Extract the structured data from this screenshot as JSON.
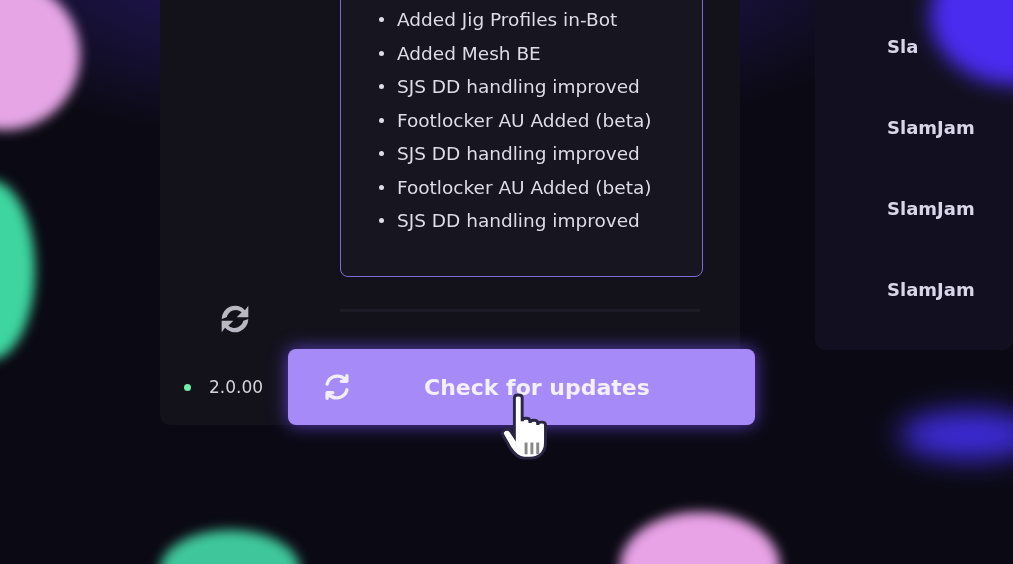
{
  "changelog": {
    "items": [
      "Added Jig Profiles in-Bot",
      "Added Mesh BE",
      "SJS DD handling improved",
      "Footlocker AU Added (beta)",
      "SJS DD handling improved",
      "Footlocker AU Added (beta)",
      "SJS DD handling improved"
    ]
  },
  "status": {
    "online": true,
    "version": "2.0.00"
  },
  "update_button": {
    "label": "Check for updates"
  },
  "site_list": {
    "items": [
      "Sla",
      "SlamJam",
      "SlamJam",
      "SlamJam"
    ]
  }
}
